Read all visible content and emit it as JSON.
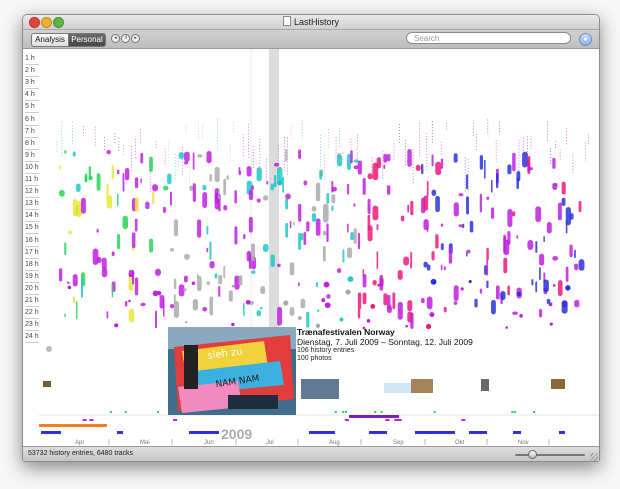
{
  "window": {
    "title": "LastHistory"
  },
  "toolbar": {
    "tabs": [
      {
        "label": "Analysis",
        "selected": false
      },
      {
        "label": "Personal",
        "selected": true
      }
    ],
    "search_placeholder": "Search"
  },
  "hour_labels": [
    "1 h",
    "2 h",
    "3 h",
    "4 h",
    "5 h",
    "6 h",
    "7 h",
    "8 h",
    "9 h",
    "10 h",
    "11 h",
    "12 h",
    "13 h",
    "14 h",
    "15 h",
    "16 h",
    "17 h",
    "18 h",
    "19 h",
    "20 h",
    "21 h",
    "22 h",
    "23 h",
    "24 h"
  ],
  "popup": {
    "title": "Trænafestivalen Norway",
    "dates": "Dienstag, 7. Juli 2009 – Sonntag, 12. Juli 2009",
    "entries": "106 history entries",
    "photos": "100 photos"
  },
  "timeline": {
    "year": "2009",
    "months": [
      "Apr",
      "Mai",
      "Jun",
      "Jul",
      "Aug",
      "Sep",
      "Okt",
      "Nov"
    ]
  },
  "status": {
    "text": "53732 history entries, 6480 tracks"
  },
  "colors": {
    "magenta": "#c020e0",
    "pink": "#ee1a7a",
    "blue": "#2a32d8",
    "cyan": "#20c8c8",
    "green": "#28d25a",
    "yellow": "#e8e83a",
    "orange": "#f08020",
    "gray": "#aaaaaa"
  }
}
